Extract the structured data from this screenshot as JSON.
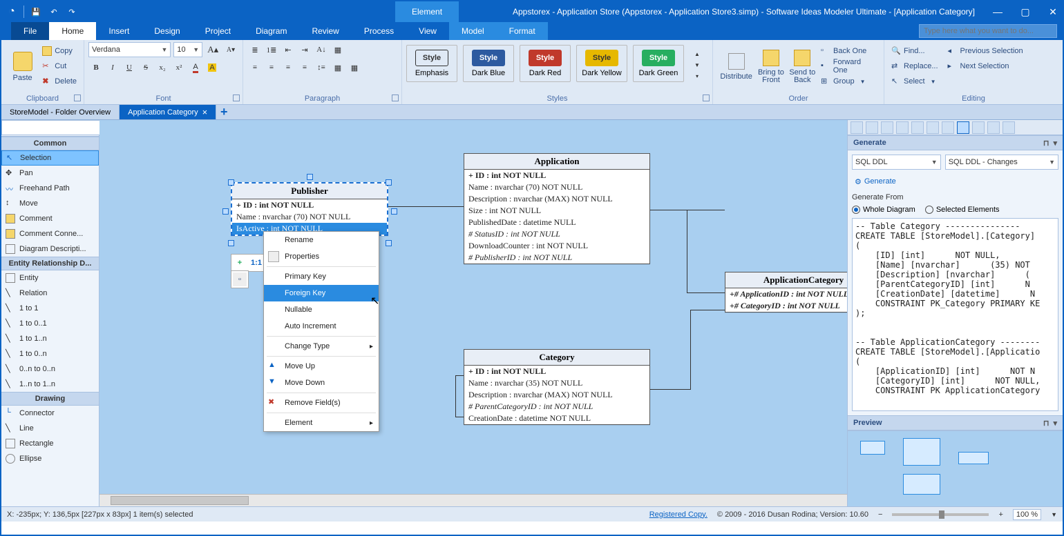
{
  "title": "Appstorex - Application Store (Appstorex - Application Store3.simp)  - Software Ideas Modeler Ultimate - [Application Category]",
  "context_tab": "Element",
  "menutabs": {
    "file": "File",
    "home": "Home",
    "insert": "Insert",
    "design": "Design",
    "project": "Project",
    "diagram": "Diagram",
    "review": "Review",
    "process": "Process",
    "view": "View",
    "model": "Model",
    "format": "Format"
  },
  "search_placeholder": "Type here what you want to do...",
  "ribbon": {
    "clipboard": {
      "paste": "Paste",
      "copy": "Copy",
      "cut": "Cut",
      "delete": "Delete",
      "label": "Clipboard"
    },
    "font": {
      "family": "Verdana",
      "size": "10",
      "label": "Font"
    },
    "paragraph": {
      "label": "Paragraph"
    },
    "styles": {
      "label": "Styles",
      "emph": "Emphasis",
      "darkblue": "Dark Blue",
      "darkred": "Dark Red",
      "darkyellow": "Dark Yellow",
      "darkgreen": "Dark Green",
      "styleword": "Style"
    },
    "order": {
      "distribute": "Distribute",
      "bringfront": "Bring to Front",
      "sendback": "Send to Back",
      "backone": "Back One",
      "forwardone": "Forward One",
      "group": "Group",
      "label": "Order"
    },
    "editing": {
      "find": "Find...",
      "replace": "Replace...",
      "select": "Select",
      "prevsel": "Previous Selection",
      "nextsel": "Next Selection",
      "label": "Editing"
    }
  },
  "doctabs": {
    "t1": "StoreModel - Folder Overview",
    "t2": "Application Category"
  },
  "breadcrumb": {
    "a": "Appstorex - Application Store",
    "b": "StoreModel",
    "c": "Application Category"
  },
  "toolbox": {
    "hdr_common": "Common",
    "selection": "Selection",
    "pan": "Pan",
    "freehand": "Freehand Path",
    "move": "Move",
    "comment": "Comment",
    "commentconn": "Comment Conne...",
    "diagdesc": "Diagram Descripti...",
    "hdr_erd": "Entity Relationship D...",
    "entity": "Entity",
    "relation": "Relation",
    "r11": "1 to 1",
    "r101": "1 to 0..1",
    "r11n": "1 to 1..n",
    "r10n": "1 to 0..n",
    "r0n0n": "0..n to 0..n",
    "r1n1n": "1..n to 1..n",
    "hdr_draw": "Drawing",
    "connector": "Connector",
    "line": "Line",
    "rect": "Rectangle",
    "ellipse": "Ellipse"
  },
  "entities": {
    "publisher": {
      "title": "Publisher",
      "rows": [
        "+ ID : int NOT NULL",
        "Name : nvarchar (70)  NOT NULL",
        "IsActive : int NOT NULL"
      ]
    },
    "application": {
      "title": "Application",
      "rows": [
        "+ ID : int NOT NULL",
        "Name : nvarchar (70)  NOT NULL",
        "Description : nvarchar (MAX)  NOT NULL",
        "Size : int NOT NULL",
        "PublishedDate : datetime NULL",
        "# StatusID : int NOT NULL",
        "DownloadCounter : int NOT NULL",
        "# PublisherID : int NOT NULL"
      ]
    },
    "appcat": {
      "title": "ApplicationCategory",
      "rows": [
        "+# ApplicationID : int NOT NULL",
        "+# CategoryID : int NOT NULL"
      ]
    },
    "category": {
      "title": "Category",
      "rows": [
        "+ ID : int NOT NULL",
        "Name : nvarchar (35)  NOT NULL",
        "Description : nvarchar (MAX)  NOT NULL",
        "# ParentCategoryID : int NOT NULL",
        "CreationDate : datetime NOT NULL"
      ]
    }
  },
  "quicktb_label": "1:1",
  "context_menu": [
    "Rename",
    "Properties",
    "Primary Key",
    "Foreign Key",
    "Nullable",
    "Auto Increment",
    "Change Type",
    "Move Up",
    "Move Down",
    "Remove Field(s)",
    "Element"
  ],
  "rightpanel": {
    "generate": "Generate",
    "combo1": "SQL DDL",
    "combo2": "SQL DDL - Changes",
    "genbtn": "Generate",
    "genfrom": "Generate From",
    "whole": "Whole Diagram",
    "selel": "Selected Elements",
    "code": "-- Table Category ---------------\nCREATE TABLE [StoreModel].[Category]\n(\n    [ID] [int]      NOT NULL,\n    [Name] [nvarchar]      (35) NOT\n    [Description] [nvarchar]      (\n    [ParentCategoryID] [int]      N\n    [CreationDate] [datetime]      N\n    CONSTRAINT PK_Category PRIMARY KE\n);\n\n\n-- Table ApplicationCategory --------\nCREATE TABLE [StoreModel].[Applicatio\n(\n    [ApplicationID] [int]      NOT N\n    [CategoryID] [int]      NOT NULL,\n    CONSTRAINT PK ApplicationCategory",
    "preview": "Preview"
  },
  "status": {
    "coords": "X: -235px; Y: 136,5px  [227px x 83px] 1 item(s) selected",
    "reg": "Registered Copy.",
    "copy": "© 2009 - 2016 Dusan Rodina; Version: 10.60",
    "zoom": "100 %"
  }
}
